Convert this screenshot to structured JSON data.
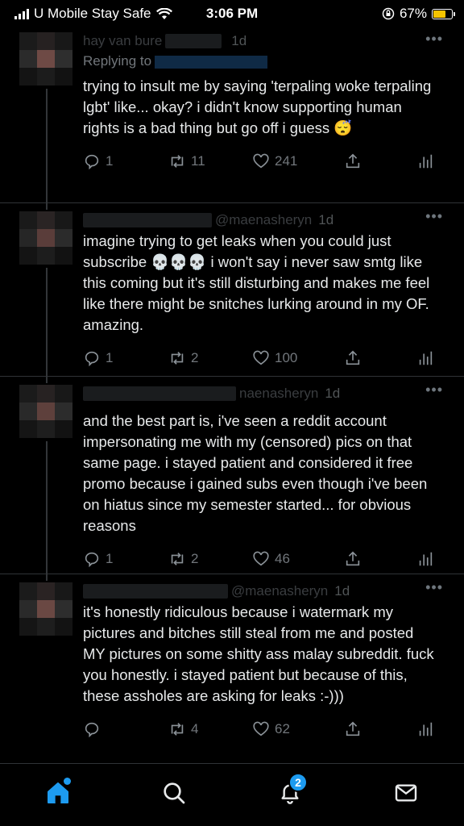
{
  "status_bar": {
    "carrier": "U Mobile Stay Safe",
    "time": "3:06 PM",
    "battery": "67%",
    "battery_level": 0.67,
    "battery_color": "#f5c400"
  },
  "tweets": [
    {
      "name": "hay van bure",
      "time": "1d",
      "replying_to": "Replying to",
      "text": "trying to insult me by saying 'terpaling woke terpaling lgbt' like... okay? i didn't know supporting human rights is a bad thing but go off i guess 😴",
      "replies": "1",
      "retweets": "11",
      "likes": "241"
    },
    {
      "name": "",
      "handle": "@maenasheryn",
      "time": "1d",
      "text": "imagine trying to get leaks when you could just subscribe 💀💀💀 i won't say i never saw smtg like this coming but it's still disturbing and makes me feel like there might be snitches lurking around in my OF. amazing.",
      "replies": "1",
      "retweets": "2",
      "likes": "100"
    },
    {
      "name": "",
      "handle": "naenasheryn",
      "time": "1d",
      "text": "and the best part is, i've seen a reddit account impersonating me with my (censored) pics on that same page. i stayed patient and considered it free promo because i gained subs even though i've been on hiatus since my semester started... for obvious reasons",
      "replies": "1",
      "retweets": "2",
      "likes": "46"
    },
    {
      "name": "",
      "handle": "@maenasheryn",
      "time": "1d",
      "text": "it's honestly ridiculous because i watermark my pictures and bitches still steal from me and posted MY pictures on some shitty ass malay subreddit. fuck you honestly. i stayed patient but because of this, these assholes are asking for leaks :-)))",
      "replies": "",
      "retweets": "4",
      "likes": "62"
    }
  ],
  "tabbar": {
    "notifications_badge": "2",
    "accent": "#1d9bf0"
  }
}
